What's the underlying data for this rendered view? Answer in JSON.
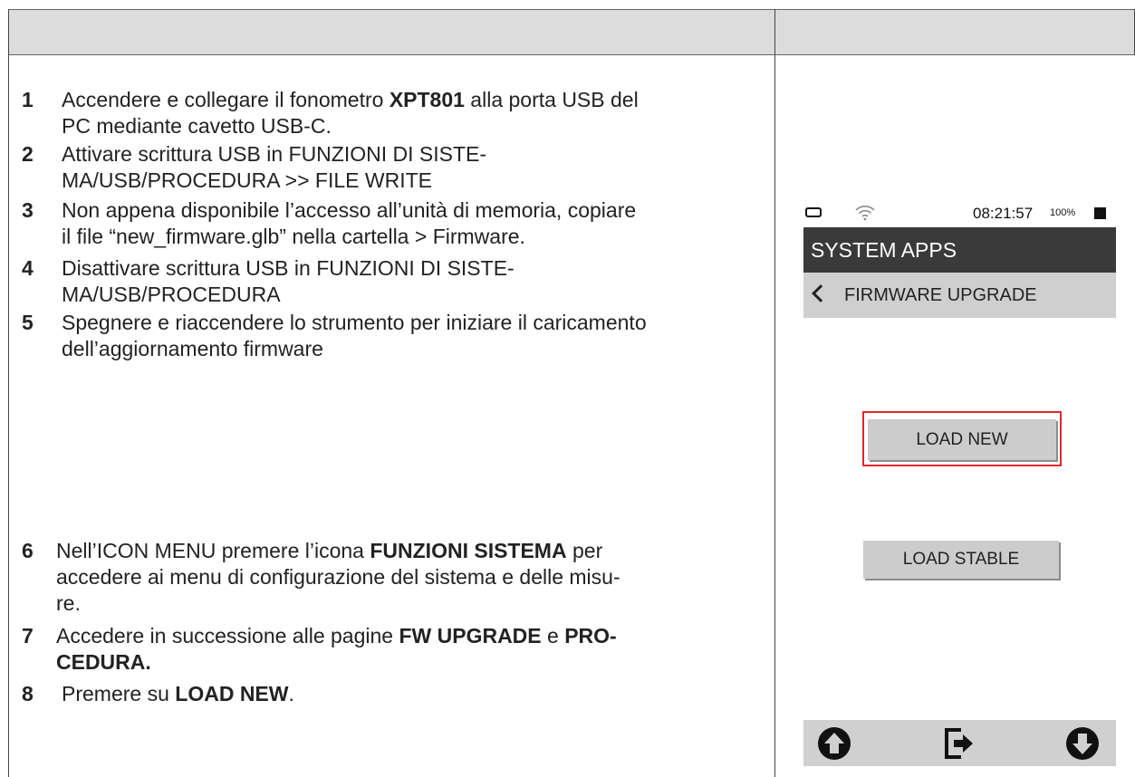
{
  "steps": [
    {
      "num": "1",
      "parts": [
        {
          "t": "Accendere e collegare il fonometro "
        },
        {
          "t": "XPT801",
          "b": true
        },
        {
          "t": " alla porta USB del"
        }
      ],
      "line2": "PC mediante cavetto USB-C."
    },
    {
      "num": "2",
      "line1": "Attivare scrittura USB in FUNZIONI DI SISTE-",
      "line2": "MA/USB/PROCEDURA >> FILE WRITE"
    },
    {
      "num": "3",
      "line1": "Non appena disponibile l’accesso all’unità di memoria, copiare",
      "line2": "il file “new_firmware.glb” nella cartella > Firmware."
    },
    {
      "num": "4",
      "line1": "Disattivare scrittura USB in FUNZIONI DI SISTE-",
      "line2": "MA/USB/PROCEDURA"
    },
    {
      "num": "5",
      "line1": "Spegnere e riaccendere lo strumento per iniziare il caricamento",
      "line2": "dell’aggiornamento firmware"
    },
    {
      "num": "6",
      "l1a": "Nell’ICON MENU premere l’icona ",
      "l1b": "FUNZIONI SISTEMA",
      "l1c": " per",
      "line2": "accedere ai menu di configurazione del sistema e delle misu-",
      "line3": "re."
    },
    {
      "num": "7",
      "l1a": "Accedere in successione alle pagine ",
      "l1b": "FW UPGRADE",
      "l1c": " e ",
      "l1d": "PRO-",
      "line2": "CEDURA."
    },
    {
      "num": "8",
      "l1a": "Premere su ",
      "l1b": "LOAD NEW",
      "l1c": "."
    }
  ],
  "device": {
    "clock": "08:21:57",
    "battery_pct": "100%",
    "title": "SYSTEM APPS",
    "subtitle": "FIRMWARE UPGRADE",
    "load_new": "LOAD NEW",
    "load_stable": "LOAD STABLE",
    "highlight_color": "#e0262b"
  },
  "icons": [
    "battery-icon",
    "wifi-icon",
    "chevron-left-icon",
    "arrow-up-icon",
    "exit-icon",
    "arrow-down-icon"
  ]
}
